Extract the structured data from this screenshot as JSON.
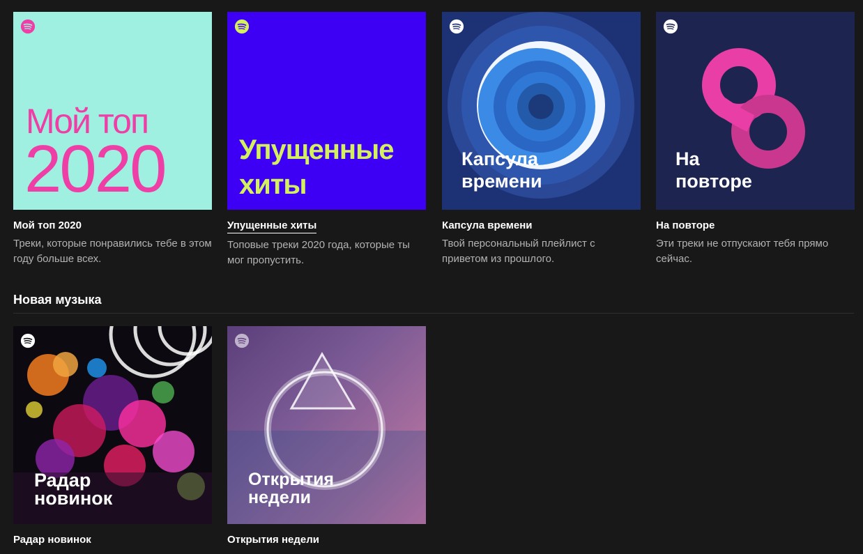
{
  "top_playlists": [
    {
      "title": "Мой топ 2020",
      "description": "Треки, которые понравились тебе в этом году больше всех.",
      "cover_line1": "Мой топ",
      "cover_line2": "2020"
    },
    {
      "title": "Упущенные хиты",
      "description": "Топовые треки 2020 года, которые ты мог пропустить.",
      "cover_line1": "Упущенные",
      "cover_line2": "хиты"
    },
    {
      "title": "Капсула времени",
      "description": "Твой персональный плейлист с приветом из прошлого.",
      "cover_line1": "Капсула",
      "cover_line2": "времени"
    },
    {
      "title": "На повторе",
      "description": "Эти треки не отпускают тебя прямо сейчас.",
      "cover_line1": "На",
      "cover_line2": "повторе"
    }
  ],
  "new_music": {
    "header": "Новая музыка",
    "playlists": [
      {
        "title": "Радар новинок",
        "cover_line1": "Радар",
        "cover_line2": "новинок"
      },
      {
        "title": "Открытия недели",
        "cover_line1": "Открытия",
        "cover_line2": "недели"
      }
    ]
  },
  "colors": {
    "background": "#181818",
    "top2020_bg": "#9ff0e1",
    "top2020_text": "#ee3fa6",
    "missed_bg": "#3d00f5",
    "missed_text": "#d4f05e",
    "capsule_bg": "#1d3275",
    "repeat_bg": "#1d2450",
    "repeat_accent": "#e83ea6"
  },
  "icons": {
    "cover_badge": "spotify-logo-icon"
  }
}
